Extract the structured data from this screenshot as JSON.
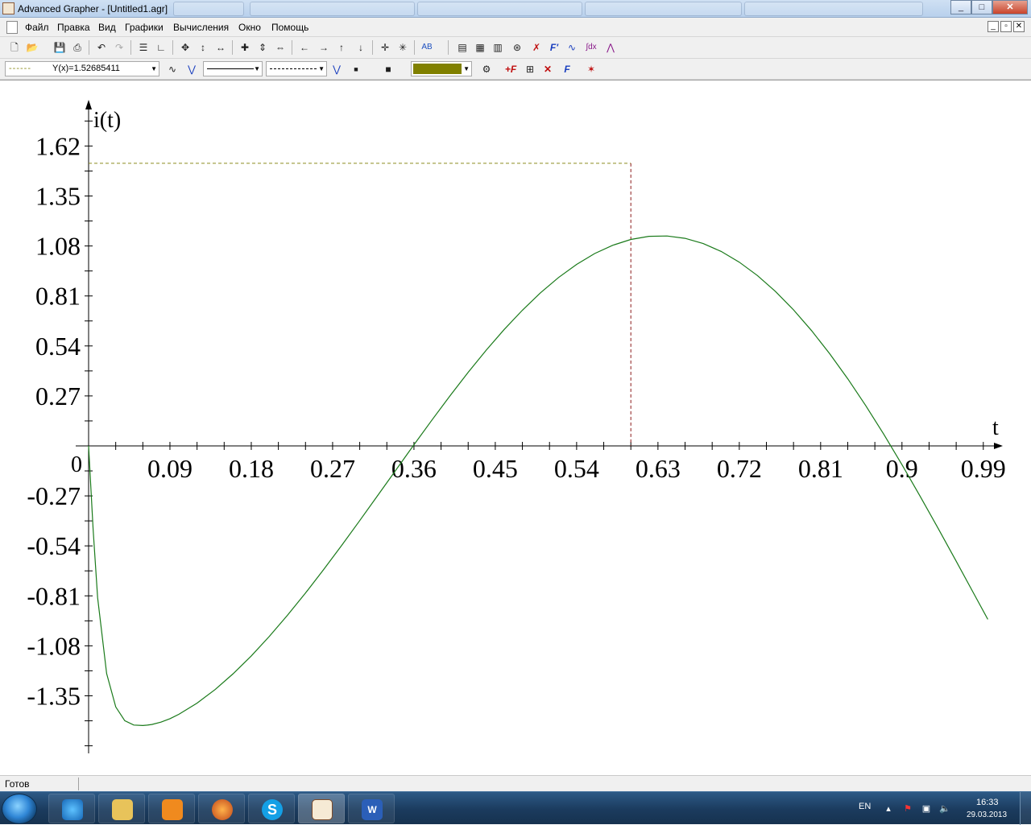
{
  "window": {
    "title": "Advanced Grapher - [Untitled1.agr]",
    "controls": {
      "minimize": "_",
      "maximize": "□",
      "close": "✕"
    }
  },
  "menu": {
    "items": [
      "Файл",
      "Правка",
      "Вид",
      "Графики",
      "Вычисления",
      "Окно",
      "Помощь"
    ]
  },
  "toolbar2": {
    "graph_select_value": "Y(x)=1.52685411",
    "line_color": "#808000"
  },
  "status": {
    "text": "Готов"
  },
  "taskbar": {
    "tray_lang": "EN",
    "time": "16:33",
    "date": "29.03.2013"
  },
  "colors": {
    "curve": "#1a7a1a",
    "trace_h": "#8c8c1e",
    "trace_v": "#8b1a1a"
  },
  "chart_data": {
    "type": "line",
    "ylabel": "i(t)",
    "xlabel": "t",
    "x_ticks": [
      "0.09",
      "0.18",
      "0.27",
      "0.36",
      "0.45",
      "0.54",
      "0.63",
      "0.72",
      "0.81",
      "0.9",
      "0.99"
    ],
    "y_ticks": [
      "1.62",
      "1.35",
      "1.08",
      "0.81",
      "0.54",
      "0.27",
      "-0.27",
      "-0.54",
      "-0.81",
      "-1.08",
      "-1.35"
    ],
    "origin_label": "0",
    "xlim": [
      0,
      1.0
    ],
    "ylim": [
      -1.65,
      1.75
    ],
    "maximum": {
      "x": 0.6,
      "y": 1.52685411
    },
    "series": [
      {
        "x": [
          0,
          0.005,
          0.01,
          0.02,
          0.03,
          0.04,
          0.05,
          0.06,
          0.065,
          0.07,
          0.08,
          0.09,
          0.1,
          0.12,
          0.14,
          0.16,
          0.18,
          0.2,
          0.22,
          0.24,
          0.26,
          0.28,
          0.3,
          0.32,
          0.34,
          0.36,
          0.38,
          0.4,
          0.42,
          0.44,
          0.46,
          0.48,
          0.5,
          0.52,
          0.54,
          0.56,
          0.58,
          0.6,
          0.62,
          0.64,
          0.66,
          0.68,
          0.7,
          0.72,
          0.74,
          0.76,
          0.78,
          0.8,
          0.82,
          0.84,
          0.86,
          0.88,
          0.9,
          0.92,
          0.94,
          0.96,
          0.98,
          0.995
        ],
        "y": [
          0,
          -0.45,
          -0.82,
          -1.23,
          -1.41,
          -1.4844,
          -1.5077,
          -1.5105,
          -1.5083,
          -1.5047,
          -1.4921,
          -1.4733,
          -1.4496,
          -1.3897,
          -1.3161,
          -1.2304,
          -1.1342,
          -1.0287,
          -0.9151,
          -0.7946,
          -0.6684,
          -0.5376,
          -0.4034,
          -0.2672,
          -0.1303,
          0.0061,
          0.1404,
          0.2713,
          0.3974,
          0.5173,
          0.6296,
          0.7332,
          0.8269,
          0.9097,
          0.9806,
          1.039,
          1.084,
          1.1152,
          1.132,
          1.134,
          1.1211,
          1.0932,
          1.0503,
          0.9927,
          0.9206,
          0.8345,
          0.735,
          0.6227,
          0.4982,
          0.3626,
          0.2168,
          0.0617,
          -0.1014,
          -0.2707,
          -0.445,
          -0.6227,
          -0.8024,
          -0.9369
        ]
      }
    ]
  }
}
